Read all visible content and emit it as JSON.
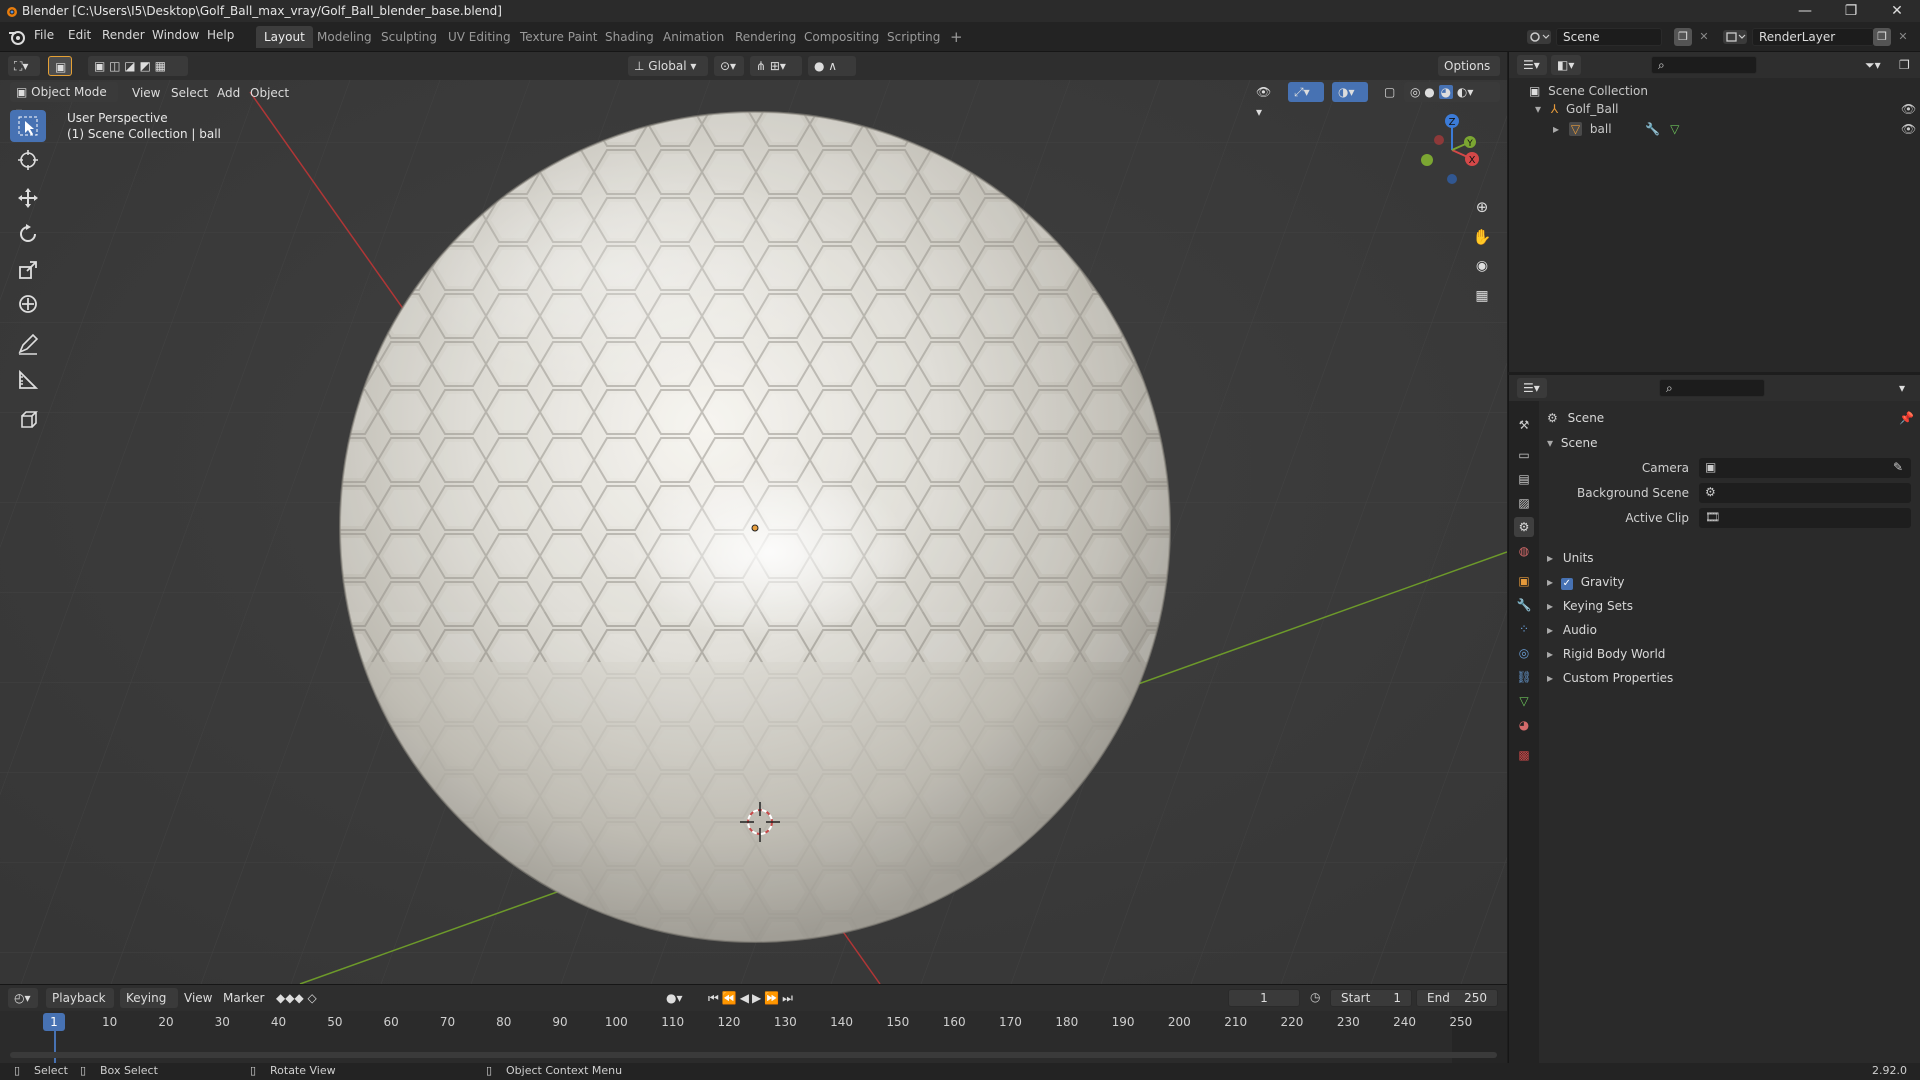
{
  "titlebar": {
    "title": "Blender [C:\\Users\\I5\\Desktop\\Golf_Ball_max_vray/Golf_Ball_blender_base.blend]",
    "minimize": "—",
    "maximize": "❐",
    "close": "✕"
  },
  "menu": {
    "items": [
      "File",
      "Edit",
      "Render",
      "Window",
      "Help"
    ]
  },
  "workspaces": {
    "tabs": [
      "Layout",
      "Modeling",
      "Sculpting",
      "UV Editing",
      "Texture Paint",
      "Shading",
      "Animation",
      "Rendering",
      "Compositing",
      "Scripting"
    ],
    "active": "Layout",
    "add": "+"
  },
  "scene_selector": {
    "value": "Scene"
  },
  "renderlayer_selector": {
    "value": "RenderLayer"
  },
  "viewport_header": {
    "transform_orientation": "Global",
    "options": "Options",
    "mode": "Object Mode",
    "menus": [
      "View",
      "Select",
      "Add",
      "Object"
    ]
  },
  "viewport": {
    "overlay_line1": "User Perspective",
    "overlay_line2": "(1) Scene Collection | ball",
    "gizmo_x": "X",
    "gizmo_y": "Y",
    "gizmo_z": "Z"
  },
  "outliner": {
    "root": "Scene Collection",
    "items": [
      {
        "label": "Golf_Ball"
      },
      {
        "label": "ball"
      }
    ]
  },
  "properties": {
    "context_label": "Scene",
    "panel_title": "Scene",
    "fields": [
      {
        "label": "Camera"
      },
      {
        "label": "Background Scene"
      },
      {
        "label": "Active Clip"
      }
    ],
    "subpanels": [
      "Units",
      "Gravity",
      "Keying Sets",
      "Audio",
      "Rigid Body World",
      "Custom Properties"
    ],
    "gravity_checked": true
  },
  "timeline": {
    "menus": [
      "Playback",
      "Keying",
      "View",
      "Marker"
    ],
    "current_frame": "1",
    "start_label": "Start",
    "start_value": "1",
    "end_label": "End",
    "end_value": "250",
    "ticks": [
      "1",
      "10",
      "20",
      "30",
      "40",
      "50",
      "60",
      "70",
      "80",
      "90",
      "100",
      "110",
      "120",
      "130",
      "140",
      "150",
      "160",
      "170",
      "180",
      "190",
      "200",
      "210",
      "220",
      "230",
      "240",
      "250"
    ]
  },
  "statusbar": {
    "select": "Select",
    "box_select": "Box Select",
    "rotate_view": "Rotate View",
    "context_menu": "Object Context Menu",
    "version": "2.92.0"
  },
  "colors": {
    "accent": "#4772b3",
    "viewport_bg": "#3c3c3c",
    "axis_x": "#c23a3a",
    "axis_y": "#6a9a2a"
  }
}
